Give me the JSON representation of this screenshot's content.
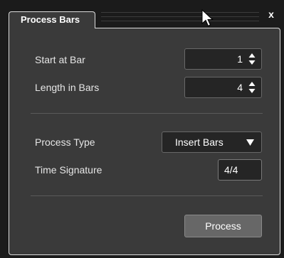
{
  "window": {
    "tab_title": "Process Bars",
    "close_label": "x"
  },
  "fields": {
    "start_at_bar": {
      "label": "Start at Bar",
      "value": "1"
    },
    "length_in_bars": {
      "label": "Length in Bars",
      "value": "4"
    },
    "process_type": {
      "label": "Process Type",
      "value": "Insert Bars"
    },
    "time_signature": {
      "label": "Time Signature",
      "value": "4/4"
    }
  },
  "actions": {
    "process_label": "Process"
  },
  "icons": {
    "close": "close-icon",
    "spin_arrows": "up-down-arrows-icon",
    "caret": "caret-down-icon",
    "cursor": "mouse-pointer-icon"
  },
  "colors": {
    "background": "#1b1b1b",
    "panel": "#3a3a3a",
    "field": "#252525",
    "button": "#676767",
    "border": "#dcdcdc"
  }
}
